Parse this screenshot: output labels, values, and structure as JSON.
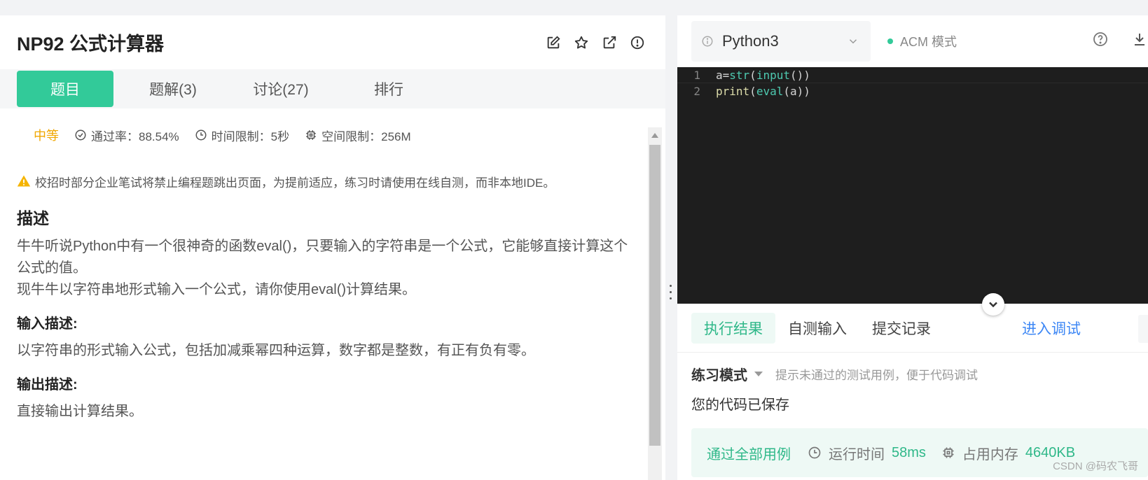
{
  "problem": {
    "title": "NP92  公式计算器",
    "tabs": [
      {
        "label": "题目",
        "active": true
      },
      {
        "label": "题解(3)"
      },
      {
        "label": "讨论(27)"
      },
      {
        "label": "排行"
      }
    ],
    "meta": {
      "difficulty": "中等",
      "pass_rate": "通过率：88.54%",
      "time_limit": "时间限制：5秒",
      "memory_limit": "空间限制：256M"
    },
    "warning": "校招时部分企业笔试将禁止编程题跳出页面，为提前适应，练习时请使用在线自测，而非本地IDE。",
    "description_heading": "描述",
    "description_line1": "牛牛听说Python中有一个很神奇的函数eval()，只要输入的字符串是一个公式，它能够直接计算这个公式的值。",
    "description_line2": "现牛牛以字符串地形式输入一个公式，请你使用eval()计算结果。",
    "input_heading": "输入描述:",
    "input_text": "以字符串的形式输入公式，包括加减乘幂四种运算，数字都是整数，有正有负有零。",
    "output_heading": "输出描述:",
    "output_text": "直接输出计算结果。"
  },
  "editor": {
    "language": "Python3",
    "mode": "ACM 模式",
    "lines": [
      {
        "num": "1",
        "code": "a=str(input())"
      },
      {
        "num": "2",
        "code": "print(eval(a))"
      }
    ]
  },
  "results": {
    "tabs": [
      {
        "label": "执行结果",
        "active": true
      },
      {
        "label": "自测输入"
      },
      {
        "label": "提交记录"
      }
    ],
    "debug_link": "进入调试",
    "mode_label": "练习模式",
    "mode_hint": "提示未通过的测试用例，便于代码调试",
    "saved_text": "您的代码已保存",
    "pass_label": "通过全部用例",
    "runtime_label": "运行时间",
    "runtime_value": "58ms",
    "memory_label": "占用内存",
    "memory_value": "4640KB"
  },
  "watermark": "CSDN @码农飞哥",
  "colors": {
    "accent": "#32ca99",
    "difficulty": "#f0a700",
    "link": "#3d87f5",
    "editor_bg": "#1e1e1e"
  }
}
